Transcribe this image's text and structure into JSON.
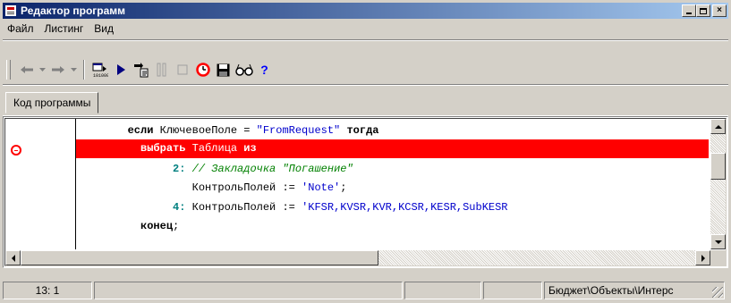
{
  "window": {
    "title": "Редактор программ",
    "controls": [
      "_",
      "□",
      "×"
    ]
  },
  "menu": [
    "Файл",
    "Листинг",
    "Вид"
  ],
  "toolbar": {
    "buttons": [
      {
        "icon": "back-arrow-icon"
      },
      {
        "icon": "back-dropdown-icon"
      },
      {
        "icon": "forward-arrow-icon"
      },
      {
        "icon": "forward-dropdown-icon"
      },
      {
        "icon": "compile-icon"
      },
      {
        "icon": "run-icon"
      },
      {
        "icon": "step-into-icon"
      },
      {
        "icon": "pause-icon"
      },
      {
        "icon": "stop-icon"
      },
      {
        "icon": "breakpoint-icon"
      },
      {
        "icon": "save-icon"
      },
      {
        "icon": "watch-icon"
      },
      {
        "icon": "help-icon"
      }
    ]
  },
  "tab": {
    "label": "Код программы"
  },
  "editor": {
    "lines": [
      {
        "indent": "        ",
        "parts": [
          {
            "t": "если",
            "c": "kw"
          },
          {
            "t": " КлючевоеПоле = ",
            "c": "ident"
          },
          {
            "t": "\"FromRequest\"",
            "c": "str"
          },
          {
            "t": " ",
            "c": "ident"
          },
          {
            "t": "тогда",
            "c": "kw"
          }
        ]
      },
      {
        "indent": "          ",
        "breakpoint": true,
        "parts": [
          {
            "t": "выбрать",
            "c": "kw-white"
          },
          {
            "t": " Таблица ",
            "c": "bp-text"
          },
          {
            "t": "из",
            "c": "kw-white"
          }
        ]
      },
      {
        "indent": "               ",
        "parts": [
          {
            "t": "2:",
            "c": "num"
          },
          {
            "t": " // Закладочка \"Погашение\"",
            "c": "cmt"
          }
        ]
      },
      {
        "indent": "                  ",
        "parts": [
          {
            "t": "КонтрольПолей := ",
            "c": "ident"
          },
          {
            "t": "'Note'",
            "c": "str"
          },
          {
            "t": ";",
            "c": "ident"
          }
        ]
      },
      {
        "indent": "               ",
        "parts": [
          {
            "t": "4:",
            "c": "num"
          },
          {
            "t": " КонтрольПолей := ",
            "c": "ident"
          },
          {
            "t": "'KFSR,KVSR,KVR,KCSR,KESR,SubKESR",
            "c": "str"
          }
        ]
      },
      {
        "indent": "          ",
        "parts": [
          {
            "t": "конец",
            "c": "kw"
          },
          {
            "t": ";",
            "c": "ident"
          }
        ]
      }
    ]
  },
  "status": {
    "position": "13: 1",
    "panel2": "",
    "panel3": "",
    "panel4": "",
    "path": "Бюджет\\Объекты\\Интерс"
  }
}
